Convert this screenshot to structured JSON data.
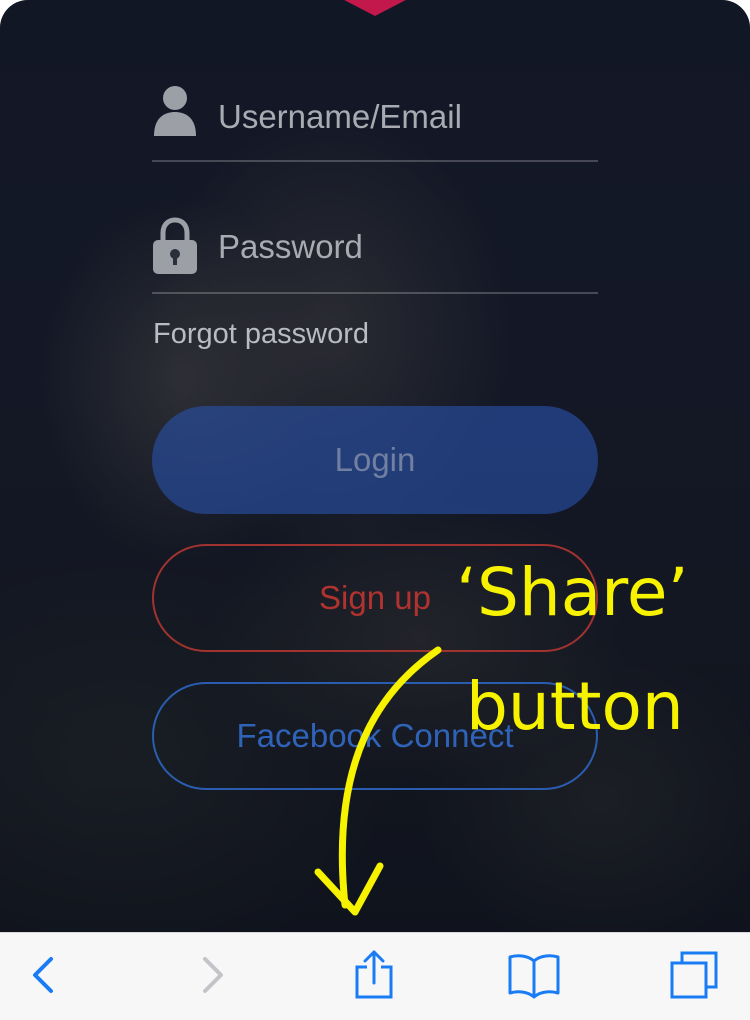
{
  "login_form": {
    "username_placeholder": "Username/Email",
    "password_placeholder": "Password",
    "forgot_password": "Forgot password",
    "login_label": "Login",
    "signup_label": "Sign up",
    "facebook_label": "Facebook Connect"
  },
  "annotation": {
    "line1": "‘Share’",
    "line2": "button"
  },
  "toolbar": {
    "icons": [
      "back-icon",
      "forward-icon",
      "share-icon",
      "bookmarks-icon",
      "tabs-icon"
    ]
  },
  "colors": {
    "accent_blue": "#2f63b8",
    "signup_red": "#b0332f",
    "annotation_yellow": "#f6f200",
    "toolbar_icon_blue": "#1a7cf5",
    "badge": "#c2184b"
  }
}
